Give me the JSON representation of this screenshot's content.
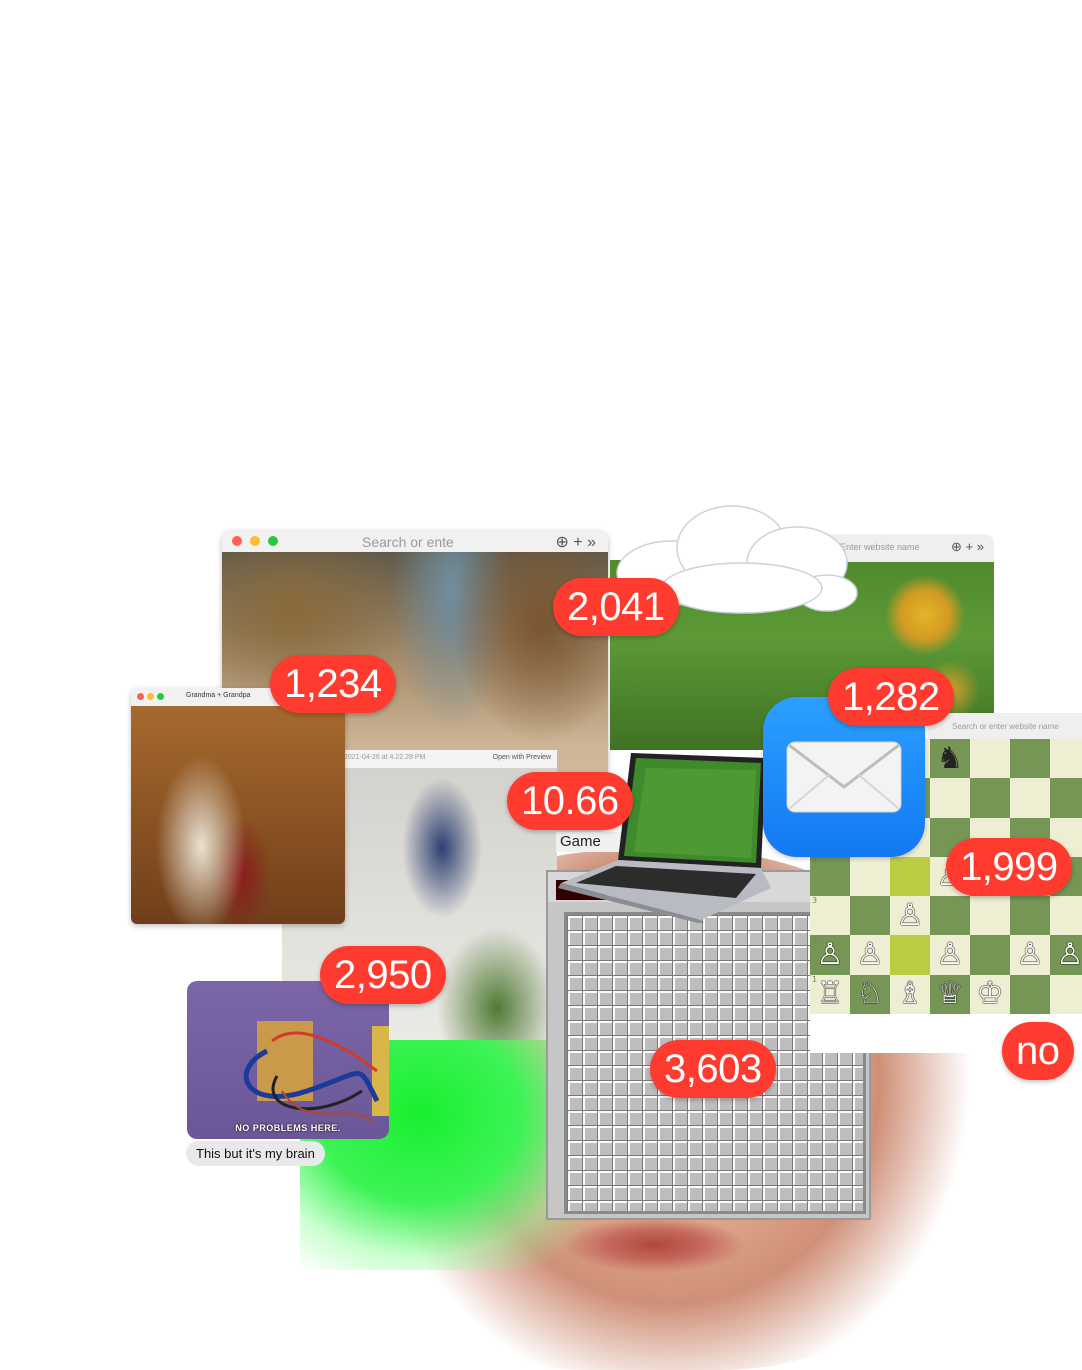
{
  "badges": {
    "b1234": "1,234",
    "b2041": "2,041",
    "b1282": "1,282",
    "b1066": "10.66",
    "b1999": "1,999",
    "b2950": "2,950",
    "b3603": "3,603",
    "bno": "no"
  },
  "windows": {
    "dunes_search": "Search or ente",
    "meadow_address": "Enter website name",
    "family_title": "Grandma + Grandpa",
    "skater_timestamp": "2021-04-26 at 4.22.28 PM",
    "skater_open": "Open with Preview",
    "chess_address": "Search or enter website name"
  },
  "minesweeper": {
    "label": "Game"
  },
  "meme": {
    "caption": "NO PROBLEMS HERE.",
    "message": "This but it's my brain"
  },
  "chess": {
    "rows": [
      {
        "rank": "",
        "cells": [
          [
            "light",
            "♛",
            "b"
          ],
          [
            "dark",
            "♚",
            "b"
          ],
          [
            "light",
            "♝",
            "b"
          ],
          [
            "dark",
            "♞",
            "b"
          ],
          [
            "light",
            "",
            ""
          ],
          [
            "dark",
            "",
            ""
          ],
          [
            "light",
            "",
            ""
          ]
        ]
      },
      {
        "rank": "",
        "cells": [
          [
            "dark",
            "♟",
            "b"
          ],
          [
            "light",
            "♟",
            "b"
          ],
          [
            "dark",
            "♟",
            "b"
          ],
          [
            "light",
            "",
            ""
          ],
          [
            "dark",
            "",
            ""
          ],
          [
            "light",
            "",
            ""
          ],
          [
            "dark",
            "",
            ""
          ]
        ]
      },
      {
        "rank": "5",
        "cells": [
          [
            "light",
            "",
            ""
          ],
          [
            "dark",
            "",
            ""
          ],
          [
            "light",
            "",
            ""
          ],
          [
            "dark",
            "",
            ""
          ],
          [
            "light",
            "",
            ""
          ],
          [
            "dark",
            "",
            ""
          ],
          [
            "light",
            "",
            ""
          ]
        ]
      },
      {
        "rank": "4",
        "cells": [
          [
            "dark",
            "",
            ""
          ],
          [
            "light",
            "",
            ""
          ],
          [
            "hl",
            "",
            ""
          ],
          [
            "light",
            "♙",
            "w"
          ],
          [
            "dark",
            "",
            ""
          ],
          [
            "light",
            "",
            ""
          ],
          [
            "dark",
            "",
            ""
          ]
        ]
      },
      {
        "rank": "3",
        "cells": [
          [
            "light",
            "",
            ""
          ],
          [
            "dark",
            "",
            ""
          ],
          [
            "light",
            "♙",
            "w"
          ],
          [
            "dark",
            "",
            ""
          ],
          [
            "light",
            "",
            ""
          ],
          [
            "dark",
            "",
            ""
          ],
          [
            "light",
            "",
            ""
          ]
        ]
      },
      {
        "rank": "2",
        "cells": [
          [
            "dark",
            "♙",
            "w"
          ],
          [
            "light",
            "♙",
            "w"
          ],
          [
            "hl",
            "",
            ""
          ],
          [
            "light",
            "♙",
            "w"
          ],
          [
            "dark",
            "",
            ""
          ],
          [
            "light",
            "♙",
            "w"
          ],
          [
            "dark",
            "♙",
            "w"
          ]
        ]
      },
      {
        "rank": "1",
        "cells": [
          [
            "light",
            "♖",
            "w"
          ],
          [
            "dark",
            "♘",
            "w"
          ],
          [
            "light",
            "♗",
            "w"
          ],
          [
            "dark",
            "♕",
            "w"
          ],
          [
            "light",
            "♔",
            "w"
          ],
          [
            "dark",
            "",
            ""
          ],
          [
            "light",
            "",
            ""
          ]
        ]
      }
    ]
  },
  "colors": {
    "badge": "#ff3b30",
    "mail_blue": "#1a86f7",
    "glow_green": "#18f02e"
  }
}
